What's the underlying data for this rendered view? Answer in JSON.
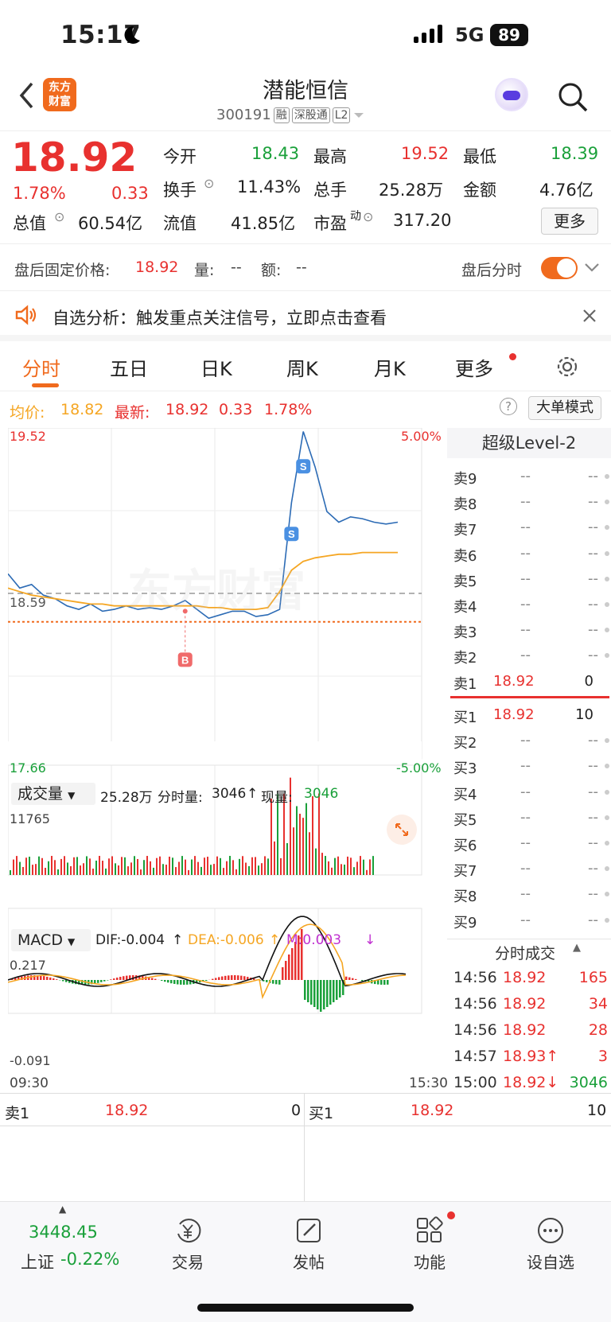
{
  "status_bar": {
    "time": "15:17",
    "network": "5G",
    "battery": "89"
  },
  "header": {
    "title": "潜能恒信",
    "code": "300191",
    "tags": [
      "融",
      "深股通",
      "L2"
    ],
    "logo_line1": "东方",
    "logo_line2": "财富"
  },
  "quote": {
    "price": "18.92",
    "pct": "1.78%",
    "change": "0.33",
    "open_label": "今开",
    "open": "18.43",
    "high_label": "最高",
    "high": "19.52",
    "low_label": "最低",
    "low": "18.39",
    "turnover_label": "换手",
    "turnover": "11.43%",
    "vol_label": "总手",
    "vol": "25.28万",
    "amount_label": "金额",
    "amount": "4.76亿",
    "mcap_label": "总值",
    "mcap": "60.54亿",
    "float_label": "流值",
    "float": "41.85亿",
    "pe_label": "市盈",
    "pe_sup": "动",
    "pe": "317.20",
    "more_label": "更多"
  },
  "after_hours": {
    "label": "盘后固定价格:",
    "price": "18.92",
    "vol_label": "量:",
    "vol": "--",
    "amt_label": "额:",
    "amt": "--",
    "toggle_label": "盘后分时",
    "toggle_on": true
  },
  "notice": {
    "text": "自选分析：触发重点关注信号，立即点击查看"
  },
  "tabs": [
    "分时",
    "五日",
    "日K",
    "周K",
    "月K",
    "更多"
  ],
  "active_tab": 0,
  "info_line": {
    "avg_label": "均价:",
    "avg": "18.82",
    "last_label": "最新:",
    "last": "18.92",
    "chg": "0.33",
    "pct": "1.78%",
    "mode_label": "大单模式"
  },
  "chart_labels": {
    "y_top": "19.52",
    "y_mid": "18.59",
    "y_bottom": "17.66",
    "pct_top": "5.00%",
    "pct_bottom": "-5.00%",
    "time_start": "09:30",
    "time_end": "15:30",
    "watermark": "东方财富"
  },
  "volume_panel": {
    "selector": "成交量",
    "total": "25.28万",
    "bar_label": "分时量:",
    "bar_value": "3046",
    "now_label": "现量:",
    "now_value": "3046",
    "max": "11765"
  },
  "macd_panel": {
    "selector": "MACD",
    "dif": "DIF:-0.004",
    "dea": "DEA:-0.006",
    "m": "M:0.003",
    "max": "0.217",
    "min": "-0.091"
  },
  "chart_data": {
    "type": "line",
    "series": [
      {
        "name": "最新",
        "values": [
          18.7,
          18.62,
          18.64,
          18.58,
          18.56,
          18.52,
          18.5,
          18.53,
          18.49,
          18.5,
          18.52,
          18.5,
          18.51,
          18.5,
          18.52,
          18.55,
          18.5,
          18.45,
          18.47,
          18.49,
          18.49,
          18.46,
          18.47,
          18.5,
          19.1,
          19.5,
          19.3,
          19.05,
          18.99,
          19.02,
          19.01,
          18.99,
          18.98,
          18.99
        ]
      },
      {
        "name": "均价",
        "values": [
          18.62,
          18.6,
          18.58,
          18.57,
          18.56,
          18.55,
          18.54,
          18.53,
          18.53,
          18.52,
          18.52,
          18.52,
          18.52,
          18.52,
          18.52,
          18.52,
          18.52,
          18.51,
          18.51,
          18.5,
          18.5,
          18.5,
          18.51,
          18.6,
          18.72,
          18.77,
          18.79,
          18.8,
          18.81,
          18.81,
          18.82,
          18.82,
          18.82,
          18.82
        ]
      }
    ],
    "ylim": [
      17.66,
      19.52
    ],
    "base": 18.59,
    "markers": [
      {
        "label": "B",
        "price": 18.49
      },
      {
        "label": "S",
        "price": 19.3
      },
      {
        "label": "S",
        "price": 18.92
      }
    ]
  },
  "order_book": {
    "title": "超级Level-2",
    "asks": [
      {
        "label": "卖9",
        "price": "--",
        "vol": "--"
      },
      {
        "label": "卖8",
        "price": "--",
        "vol": "--"
      },
      {
        "label": "卖7",
        "price": "--",
        "vol": "--"
      },
      {
        "label": "卖6",
        "price": "--",
        "vol": "--"
      },
      {
        "label": "卖5",
        "price": "--",
        "vol": "--"
      },
      {
        "label": "卖4",
        "price": "--",
        "vol": "--"
      },
      {
        "label": "卖3",
        "price": "--",
        "vol": "--"
      },
      {
        "label": "卖2",
        "price": "--",
        "vol": "--"
      },
      {
        "label": "卖1",
        "price": "18.92",
        "vol": "0"
      }
    ],
    "bids": [
      {
        "label": "买1",
        "price": "18.92",
        "vol": "10"
      },
      {
        "label": "买2",
        "price": "--",
        "vol": "--"
      },
      {
        "label": "买3",
        "price": "--",
        "vol": "--"
      },
      {
        "label": "买4",
        "price": "--",
        "vol": "--"
      },
      {
        "label": "买5",
        "price": "--",
        "vol": "--"
      },
      {
        "label": "买6",
        "price": "--",
        "vol": "--"
      },
      {
        "label": "买7",
        "price": "--",
        "vol": "--"
      },
      {
        "label": "买8",
        "price": "--",
        "vol": "--"
      },
      {
        "label": "买9",
        "price": "--",
        "vol": "--"
      }
    ],
    "trades_title": "分时成交",
    "trades": [
      {
        "time": "14:56",
        "price": "18.92",
        "vol": "165"
      },
      {
        "time": "14:56",
        "price": "18.92",
        "vol": "34"
      },
      {
        "time": "14:56",
        "price": "18.92",
        "vol": "28"
      },
      {
        "time": "14:57",
        "price": "18.93↑",
        "vol": "3"
      },
      {
        "time": "15:00",
        "price": "18.92↓",
        "vol": "3046"
      }
    ]
  },
  "bottom_quote": {
    "ask_label": "卖1",
    "ask_price": "18.92",
    "ask_vol": "0",
    "bid_label": "买1",
    "bid_price": "18.92",
    "bid_vol": "10"
  },
  "index": {
    "value": "3448.45",
    "name": "上证",
    "pct": "-0.22%"
  },
  "tabbar": [
    {
      "label": "交易",
      "icon": "yen-cycle-icon"
    },
    {
      "label": "发帖",
      "icon": "edit-icon"
    },
    {
      "label": "功能",
      "icon": "grid-icon"
    },
    {
      "label": "设自选",
      "icon": "more-circle-icon"
    }
  ]
}
